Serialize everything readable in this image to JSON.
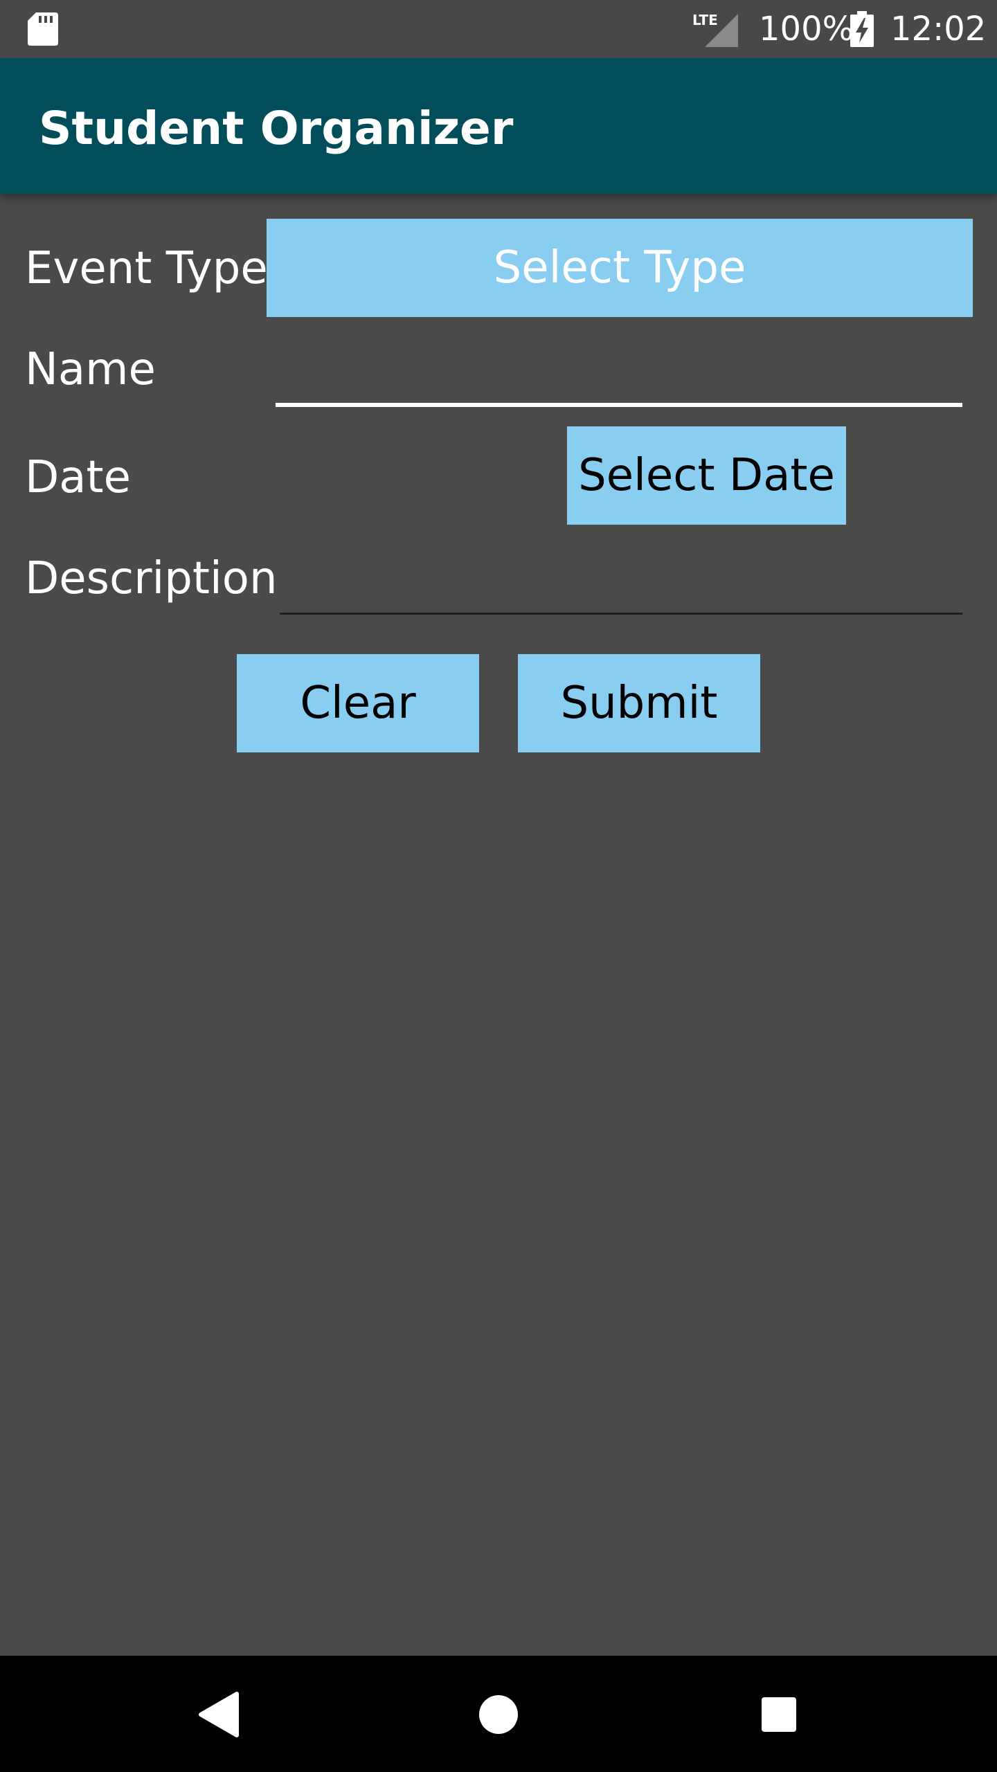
{
  "status_bar": {
    "network_label": "LTE",
    "battery_percent": "100%",
    "time": "12:02",
    "icons": [
      "sd-card-icon",
      "lte-signal-icon",
      "battery-charging-icon"
    ]
  },
  "app_bar": {
    "title": "Student Organizer",
    "background_color": "#024d5a"
  },
  "form": {
    "event_type_label": "Event Type",
    "event_type_button": "Select Type",
    "name_label": "Name",
    "name_value": "",
    "date_label": "Date",
    "date_button": "Select Date",
    "description_label": "Description",
    "description_value": "",
    "clear_button": "Clear",
    "submit_button": "Submit",
    "button_color": "#89cdf1"
  },
  "nav_bar": {
    "icons": [
      "back-icon",
      "home-icon",
      "recents-icon"
    ]
  },
  "colors": {
    "background": "#4a4a4a",
    "status_bar": "#484848",
    "nav_bar": "#000000"
  }
}
